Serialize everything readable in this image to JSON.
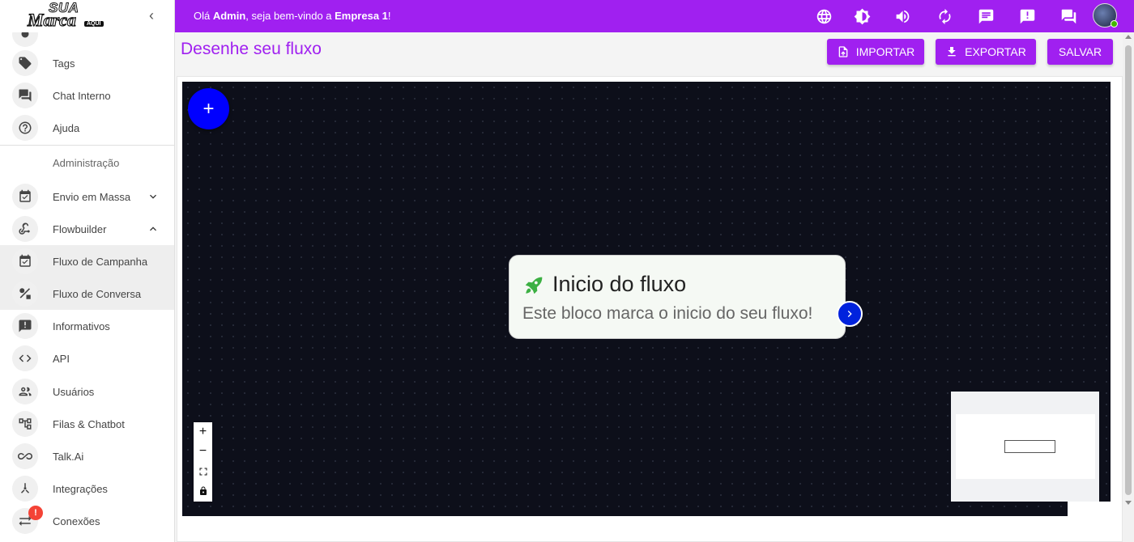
{
  "logo": {
    "line1": "SUA",
    "line2": "Marca",
    "line3": "AQUI"
  },
  "sidebar": {
    "items": [
      {
        "label": "Tags",
        "icon": "tag-icon"
      },
      {
        "label": "Chat Interno",
        "icon": "chat-icon"
      },
      {
        "label": "Ajuda",
        "icon": "help-icon"
      },
      {
        "label": "Envio em Massa",
        "icon": "event-check-icon"
      },
      {
        "label": "Flowbuilder",
        "icon": "webhook-icon"
      },
      {
        "label": "Fluxo de Campanha",
        "icon": "event-check-icon"
      },
      {
        "label": "Fluxo de Conversa",
        "icon": "shapes-icon"
      },
      {
        "label": "Informativos",
        "icon": "announcement-icon"
      },
      {
        "label": "API",
        "icon": "code-icon"
      },
      {
        "label": "Usuários",
        "icon": "people-icon"
      },
      {
        "label": "Filas & Chatbot",
        "icon": "account-tree-icon"
      },
      {
        "label": "Talk.Ai",
        "icon": "infinity-icon"
      },
      {
        "label": "Integrações",
        "icon": "hub-icon"
      },
      {
        "label": "Conexões",
        "icon": "sync-alt-icon"
      }
    ],
    "section_admin": "Administração",
    "connections_badge": "!"
  },
  "topbar": {
    "welcome_prefix": "Olá ",
    "user": "Admin",
    "welcome_middle": ", seja bem-vindo a ",
    "company": "Empresa 1",
    "welcome_suffix": "!",
    "bg_color": "#a020f0"
  },
  "page": {
    "title": "Desenhe seu fluxo",
    "import_label": "IMPORTAR",
    "export_label": "EXPORTAR",
    "save_label": "SALVAR"
  },
  "flow": {
    "add_button": "+",
    "start_node": {
      "title": "Inicio do fluxo",
      "subtitle": "Este bloco marca o inicio do seu fluxo!",
      "icon": "rocket-icon"
    },
    "controls": {
      "zoom_in": "+",
      "zoom_out": "−"
    }
  }
}
